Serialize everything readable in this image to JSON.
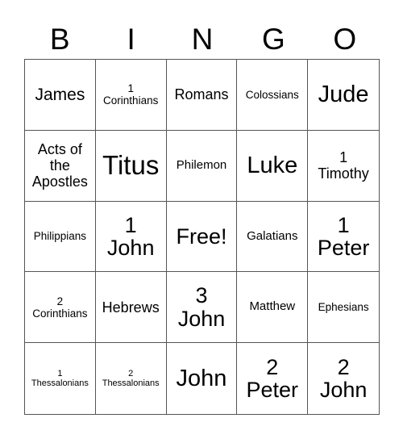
{
  "header": {
    "letters": [
      "B",
      "I",
      "N",
      "G",
      "O"
    ]
  },
  "grid": {
    "rows": [
      [
        {
          "line1": "James",
          "line2": ""
        },
        {
          "line1": "1",
          "line2": "Corinthians"
        },
        {
          "line1": "Romans",
          "line2": ""
        },
        {
          "line1": "Colossians",
          "line2": ""
        },
        {
          "line1": "Jude",
          "line2": ""
        }
      ],
      [
        {
          "line1": "Acts of the Apostles",
          "line2": ""
        },
        {
          "line1": "Titus",
          "line2": ""
        },
        {
          "line1": "Philemon",
          "line2": ""
        },
        {
          "line1": "Luke",
          "line2": ""
        },
        {
          "line1": "1",
          "line2": "Timothy"
        }
      ],
      [
        {
          "line1": "Philippians",
          "line2": ""
        },
        {
          "line1": "1",
          "line2": "John"
        },
        {
          "line1": "Free!",
          "line2": ""
        },
        {
          "line1": "Galatians",
          "line2": ""
        },
        {
          "line1": "1",
          "line2": "Peter"
        }
      ],
      [
        {
          "line1": "2",
          "line2": "Corinthians"
        },
        {
          "line1": "Hebrews",
          "line2": ""
        },
        {
          "line1": "3",
          "line2": "John"
        },
        {
          "line1": "Matthew",
          "line2": ""
        },
        {
          "line1": "Ephesians",
          "line2": ""
        }
      ],
      [
        {
          "line1": "1",
          "line2": "Thessalonians"
        },
        {
          "line1": "2",
          "line2": "Thessalonians"
        },
        {
          "line1": "John",
          "line2": ""
        },
        {
          "line1": "2",
          "line2": "Peter"
        },
        {
          "line1": "2",
          "line2": "John"
        }
      ]
    ]
  }
}
